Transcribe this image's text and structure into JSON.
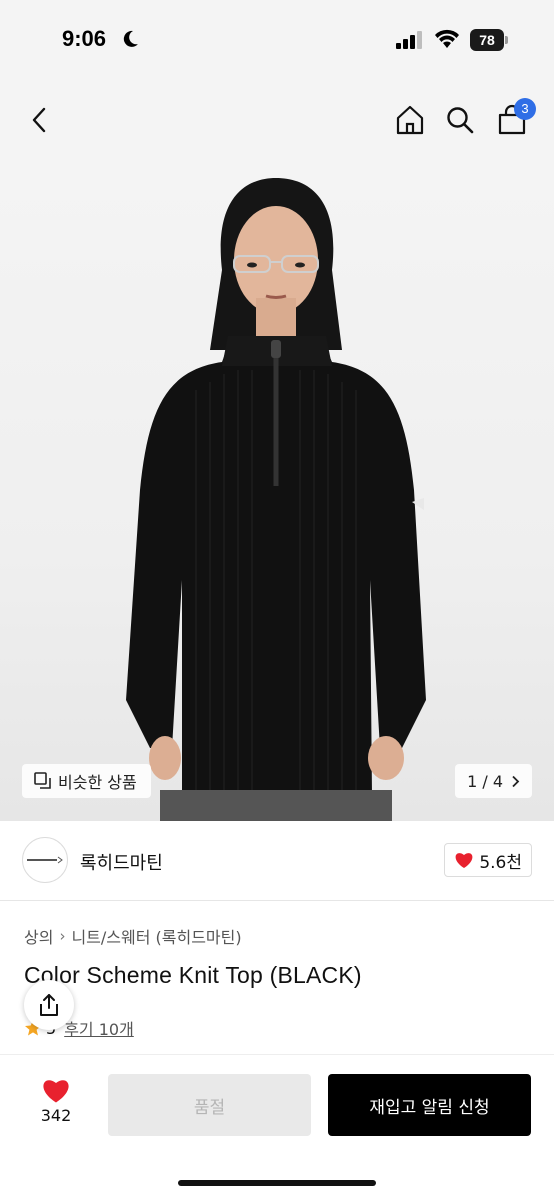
{
  "status_bar": {
    "time": "9:06",
    "battery": "78",
    "icons": [
      "moon-icon",
      "signal-icon",
      "wifi-icon",
      "battery-icon"
    ]
  },
  "header": {
    "icons": [
      "back-icon",
      "home-icon",
      "search-icon",
      "shopping-bag-icon"
    ],
    "cart_count": "3",
    "cart_badge_color": "#2f6ee6"
  },
  "gallery": {
    "similar_label": "비슷한 상품",
    "page_indicator": "1 / 4"
  },
  "brand": {
    "name": "록히드마틴",
    "likes": "5.6천"
  },
  "product": {
    "breadcrumb": [
      "상의",
      "니트/스웨터 (록히드마틴)"
    ],
    "title": "Color Scheme Knit Top (BLACK)",
    "rating": "5",
    "review_label": "후기 10개"
  },
  "actions": {
    "wish_count": "342",
    "soldout_label": "품절",
    "restock_label": "재입고 알림 신청",
    "heart_color": "#e8212e"
  }
}
